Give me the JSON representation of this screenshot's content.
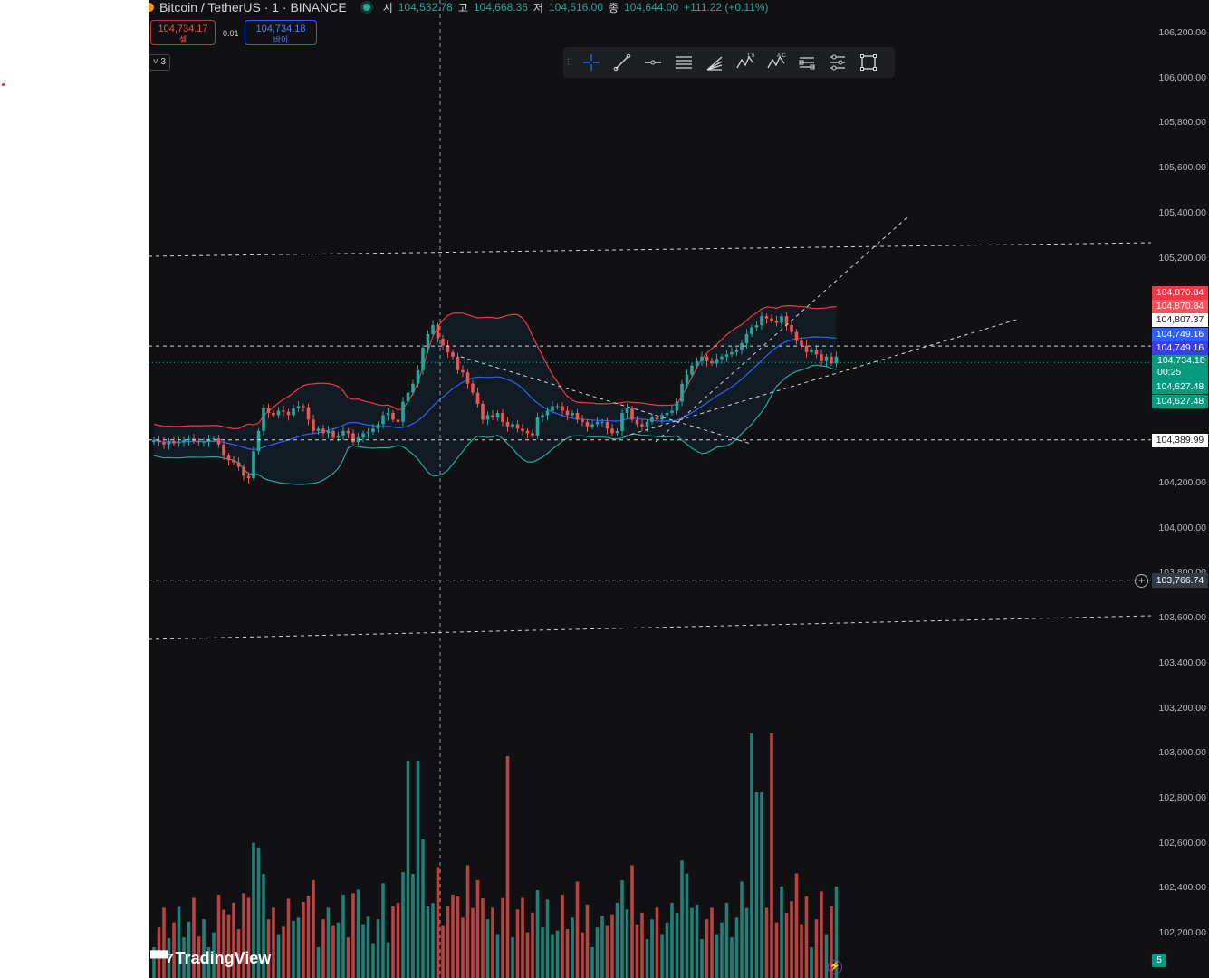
{
  "header": {
    "symbol": "Bitcoin / TetherUS · 1 · BINANCE",
    "open_label": "시",
    "open": "104,532.78",
    "high_label": "고",
    "high": "104,668.36",
    "low_label": "저",
    "low": "104,516.00",
    "close_label": "종",
    "close": "104,644.00",
    "change": "+111.22 (+0.11%)"
  },
  "trade": {
    "sell_price": "104,734.17",
    "sell_label": "셀",
    "spread": "0.01",
    "buy_price": "104,734.18",
    "buy_label": "바이"
  },
  "indicator_count": "3",
  "toolbar": {
    "tools": [
      "crosshair-icon",
      "trend-line-icon",
      "horizontal-ray-icon",
      "parallel-channel-icon",
      "fib-fan-icon",
      "elliott-wave-icon",
      "abcd-pattern-icon",
      "date-price-range-icon",
      "ranges-icon",
      "rectangle-icon"
    ],
    "labels": [
      "",
      "",
      "",
      "",
      "",
      "1 5",
      "A C",
      "",
      "",
      ""
    ]
  },
  "price_axis": {
    "ticks": [
      "106,200.00",
      "106,000.00",
      "105,800.00",
      "105,600.00",
      "105,400.00",
      "105,200.00",
      "104,200.00",
      "104,000.00",
      "103,800.00",
      "103,600.00",
      "103,400.00",
      "103,200.00",
      "103,000.00",
      "102,800.00",
      "102,600.00",
      "102,400.00",
      "102,200.00"
    ],
    "tags": [
      {
        "value": "104,870.84",
        "color": "#f23645"
      },
      {
        "value": "104,870.84",
        "color": "#f7525f"
      },
      {
        "value": "104,807.37",
        "color": "#ffffff",
        "text_color": "#131722"
      },
      {
        "value": "104,749.16",
        "color": "#2962ff"
      },
      {
        "value": "104,749.16",
        "color": "#3b3bf0"
      },
      {
        "value": "104,734.18",
        "color": "#089981",
        "sub": "00:25"
      },
      {
        "value": "104,627.48",
        "color": "#089981"
      },
      {
        "value": "104,627.48",
        "color": "#089981"
      },
      {
        "value": "104,389.99",
        "color": "#ffffff",
        "text_color": "#131722"
      }
    ],
    "crosshair_price": "103,766.74"
  },
  "branding": {
    "logo_text": "TradingView",
    "badge": "5"
  },
  "colors": {
    "up": "#26a69a",
    "down": "#ef5350",
    "basis": "#2962ff",
    "upper": "#f23645",
    "lower": "#26a69a",
    "background": "#111113"
  },
  "chart_data": {
    "type": "candlestick",
    "symbol": "BTCUSDT",
    "interval": "1",
    "ylim": [
      102100,
      106300
    ],
    "price_ticks": [
      106200,
      106000,
      105800,
      105600,
      105400,
      105200,
      104200,
      104000,
      103800,
      103600,
      103400,
      103200,
      103000,
      102800,
      102600,
      102400,
      102200
    ],
    "indicators": [
      "Bollinger Bands",
      "Volume"
    ],
    "closes": [
      104390,
      104380,
      104370,
      104385,
      104375,
      104380,
      104390,
      104395,
      104385,
      104380,
      104382,
      104392,
      104396,
      104370,
      104320,
      104300,
      104290,
      104270,
      104230,
      104220,
      104340,
      104430,
      104530,
      104510,
      104500,
      104520,
      104515,
      104500,
      104530,
      104540,
      104535,
      104480,
      104430,
      104440,
      104420,
      104430,
      104400,
      104410,
      104430,
      104420,
      104380,
      104400,
      104420,
      104425,
      104440,
      104460,
      104500,
      104510,
      104480,
      104470,
      104560,
      104600,
      104640,
      104700,
      104800,
      104860,
      104900,
      104840,
      104810,
      104780,
      104760,
      104700,
      104690,
      104640,
      104600,
      104550,
      104480,
      104500,
      104490,
      104510,
      104470,
      104450,
      104460,
      104440,
      104430,
      104420,
      104410,
      104490,
      104500,
      104520,
      104540,
      104540,
      104520,
      104500,
      104510,
      104480,
      104470,
      104450,
      104460,
      104470,
      104470,
      104440,
      104420,
      104430,
      104510,
      104530,
      104480,
      104460,
      104450,
      104470,
      104490,
      104480,
      104500,
      104510,
      104520,
      104560,
      104640,
      104680,
      104720,
      104740,
      104760,
      104740,
      104730,
      104750,
      104760,
      104770,
      104780,
      104790,
      104820,
      104860,
      104890,
      104900,
      104940,
      104930,
      104920,
      104910,
      104940,
      104900,
      104870,
      104830,
      104810,
      104780,
      104790,
      104770,
      104740,
      104760,
      104730,
      104760
    ],
    "annotations": {
      "horizontal_levels": [
        104807.37,
        104389.99,
        103766.74
      ],
      "crosshair_price": 103766.74
    }
  }
}
